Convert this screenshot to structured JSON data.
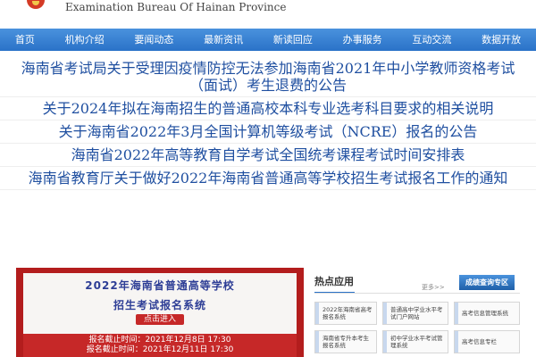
{
  "header": {
    "bureau_name_en": "Examination Bureau Of Hainan Province"
  },
  "nav": {
    "items": [
      "首页",
      "机构介绍",
      "要闻动态",
      "最新资讯",
      "新读回应",
      "办事服务",
      "互动交流",
      "数据开放"
    ]
  },
  "headlines": [
    "海南省考试局关于受理因疫情防控无法参加海南省2021年中小学教师资格考试（面试）考生退费的公告",
    "关于2024年拟在海南招生的普通高校本科专业选考科目要求的相关说明",
    "关于海南省2022年3月全国计算机等级考试（NCRE）报名的公告",
    "海南省2022年高等教育自学考试全国统考课程考试时间安排表",
    "海南省教育厅关于做好2022年海南省普通高等学校招生考试报名工作的通知"
  ],
  "banner": {
    "title_line1": "2022年海南省普通高等学校",
    "title_line2": "招生考试报名系统",
    "button": "点击进入",
    "date_line1": "报名截止时间：2021年12月8日 17:30",
    "date_line2": "报名截止时间：2021年12月11日 17:30"
  },
  "hot_apps": {
    "title": "热点应用",
    "more": "更多>>",
    "badge": "成绩查询专区",
    "tiles": [
      "2022年海南省高考报名系统",
      "普通高中学业水平考试门户网站",
      "高考信息管理系统",
      "海南省专升本考生报名系统",
      "初中学业水平考试管理系统",
      "高考信息专栏"
    ]
  },
  "colors": {
    "nav_bg": "#2a72c8",
    "headline_text": "#1f4fa0",
    "banner_red": "#c62828"
  }
}
